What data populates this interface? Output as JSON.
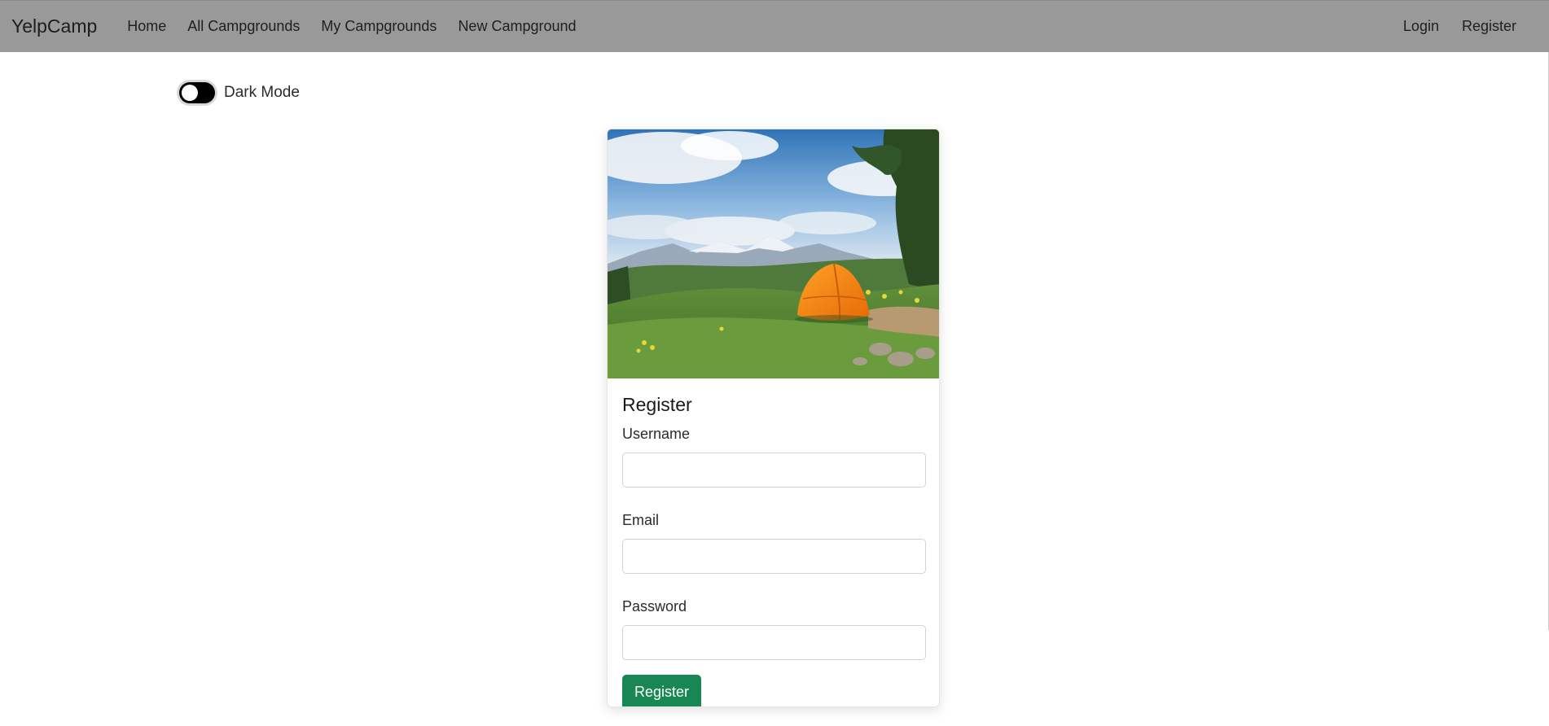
{
  "navbar": {
    "brand": "YelpCamp",
    "links": [
      {
        "label": "Home"
      },
      {
        "label": "All Campgrounds"
      },
      {
        "label": "My Campgrounds"
      },
      {
        "label": "New Campground"
      }
    ],
    "right_links": [
      {
        "label": "Login"
      },
      {
        "label": "Register"
      }
    ]
  },
  "dark_mode": {
    "label": "Dark Mode",
    "enabled": false
  },
  "register_card": {
    "image_icon": "camping-tent-photo",
    "title": "Register",
    "fields": {
      "username": {
        "label": "Username",
        "value": ""
      },
      "email": {
        "label": "Email",
        "value": ""
      },
      "password": {
        "label": "Password",
        "value": ""
      }
    },
    "submit_label": "Register"
  },
  "colors": {
    "navbar_bg": "#999999",
    "primary_button": "#198754",
    "toggle_track": "#000000"
  }
}
